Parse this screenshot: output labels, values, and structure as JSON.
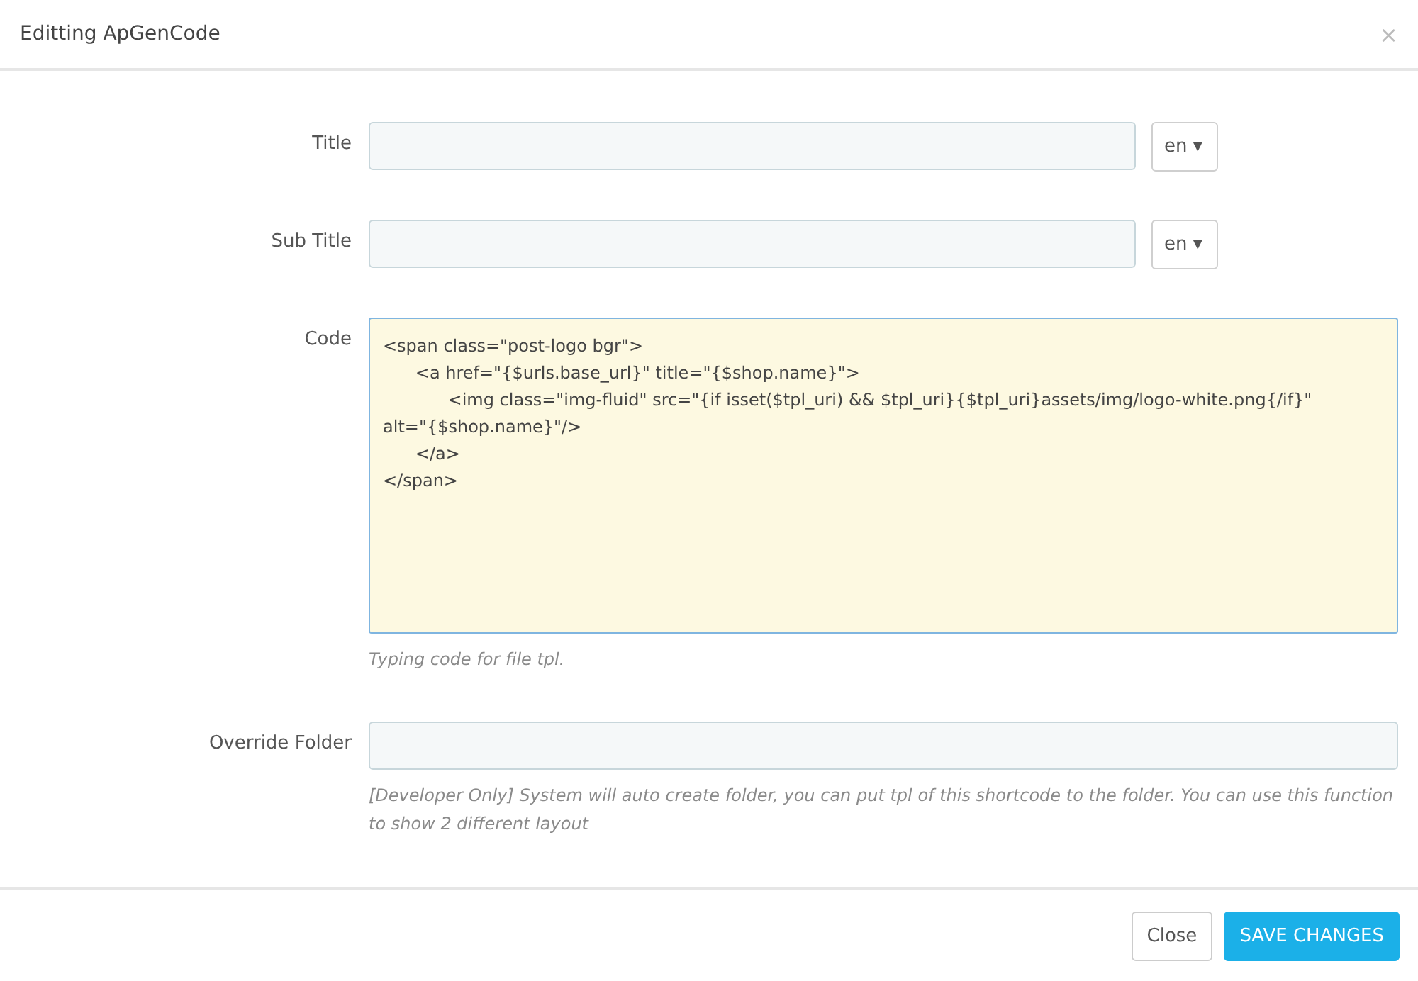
{
  "dialog": {
    "title": "Editting ApGenCode",
    "close": "×"
  },
  "fields": [
    {
      "kind": "text",
      "label": "Title",
      "language": "en",
      "caret": "▾"
    },
    {
      "kind": "text",
      "label": "Sub Title",
      "language": "en",
      "caret": "▾"
    },
    {
      "kind": "code",
      "label": "Code",
      "value": "<span class=\"post-logo bgr\">\n\t<a href=\"{$urls.base_url}\" title=\"{$shop.name}\">\n\t\t<img class=\"img-fluid\" src=\"{if isset($tpl_uri) && $tpl_uri}{$tpl_uri}assets/img/logo-white.png{/if}\" alt=\"{$shop.name}\"/>\n\t</a>\n</span>",
      "help": "Typing code for file tpl."
    },
    {
      "kind": "plain",
      "label": "Override Folder",
      "help": "[Developer Only] System will auto create folder, you can put tpl of this shortcode to the folder. You can use this function to show 2 different layout"
    }
  ],
  "buttons": [
    {
      "label": "Close",
      "kind": "default"
    },
    {
      "label": "SAVE CHANGES",
      "kind": "primary"
    }
  ]
}
